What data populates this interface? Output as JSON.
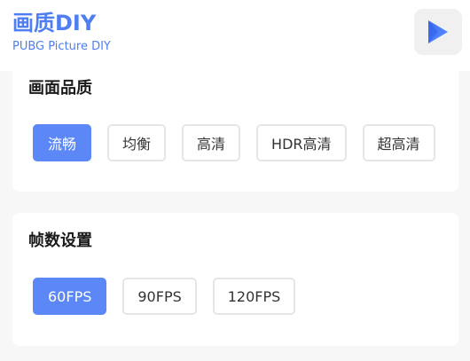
{
  "header": {
    "title": "画质DIY",
    "subtitle": "PUBG Picture DIY",
    "play_icon": "play-triangle-icon",
    "accent_color": "#4f7df2"
  },
  "quality": {
    "title": "画面品质",
    "options": [
      "流畅",
      "均衡",
      "高清",
      "HDR高清",
      "超高清"
    ],
    "selected": "流畅"
  },
  "fps": {
    "title": "帧数设置",
    "options": [
      "60FPS",
      "90FPS",
      "120FPS"
    ],
    "selected": "60FPS"
  },
  "colors": {
    "selected_bg": "#5b87f7",
    "border": "#e6e6e6"
  }
}
